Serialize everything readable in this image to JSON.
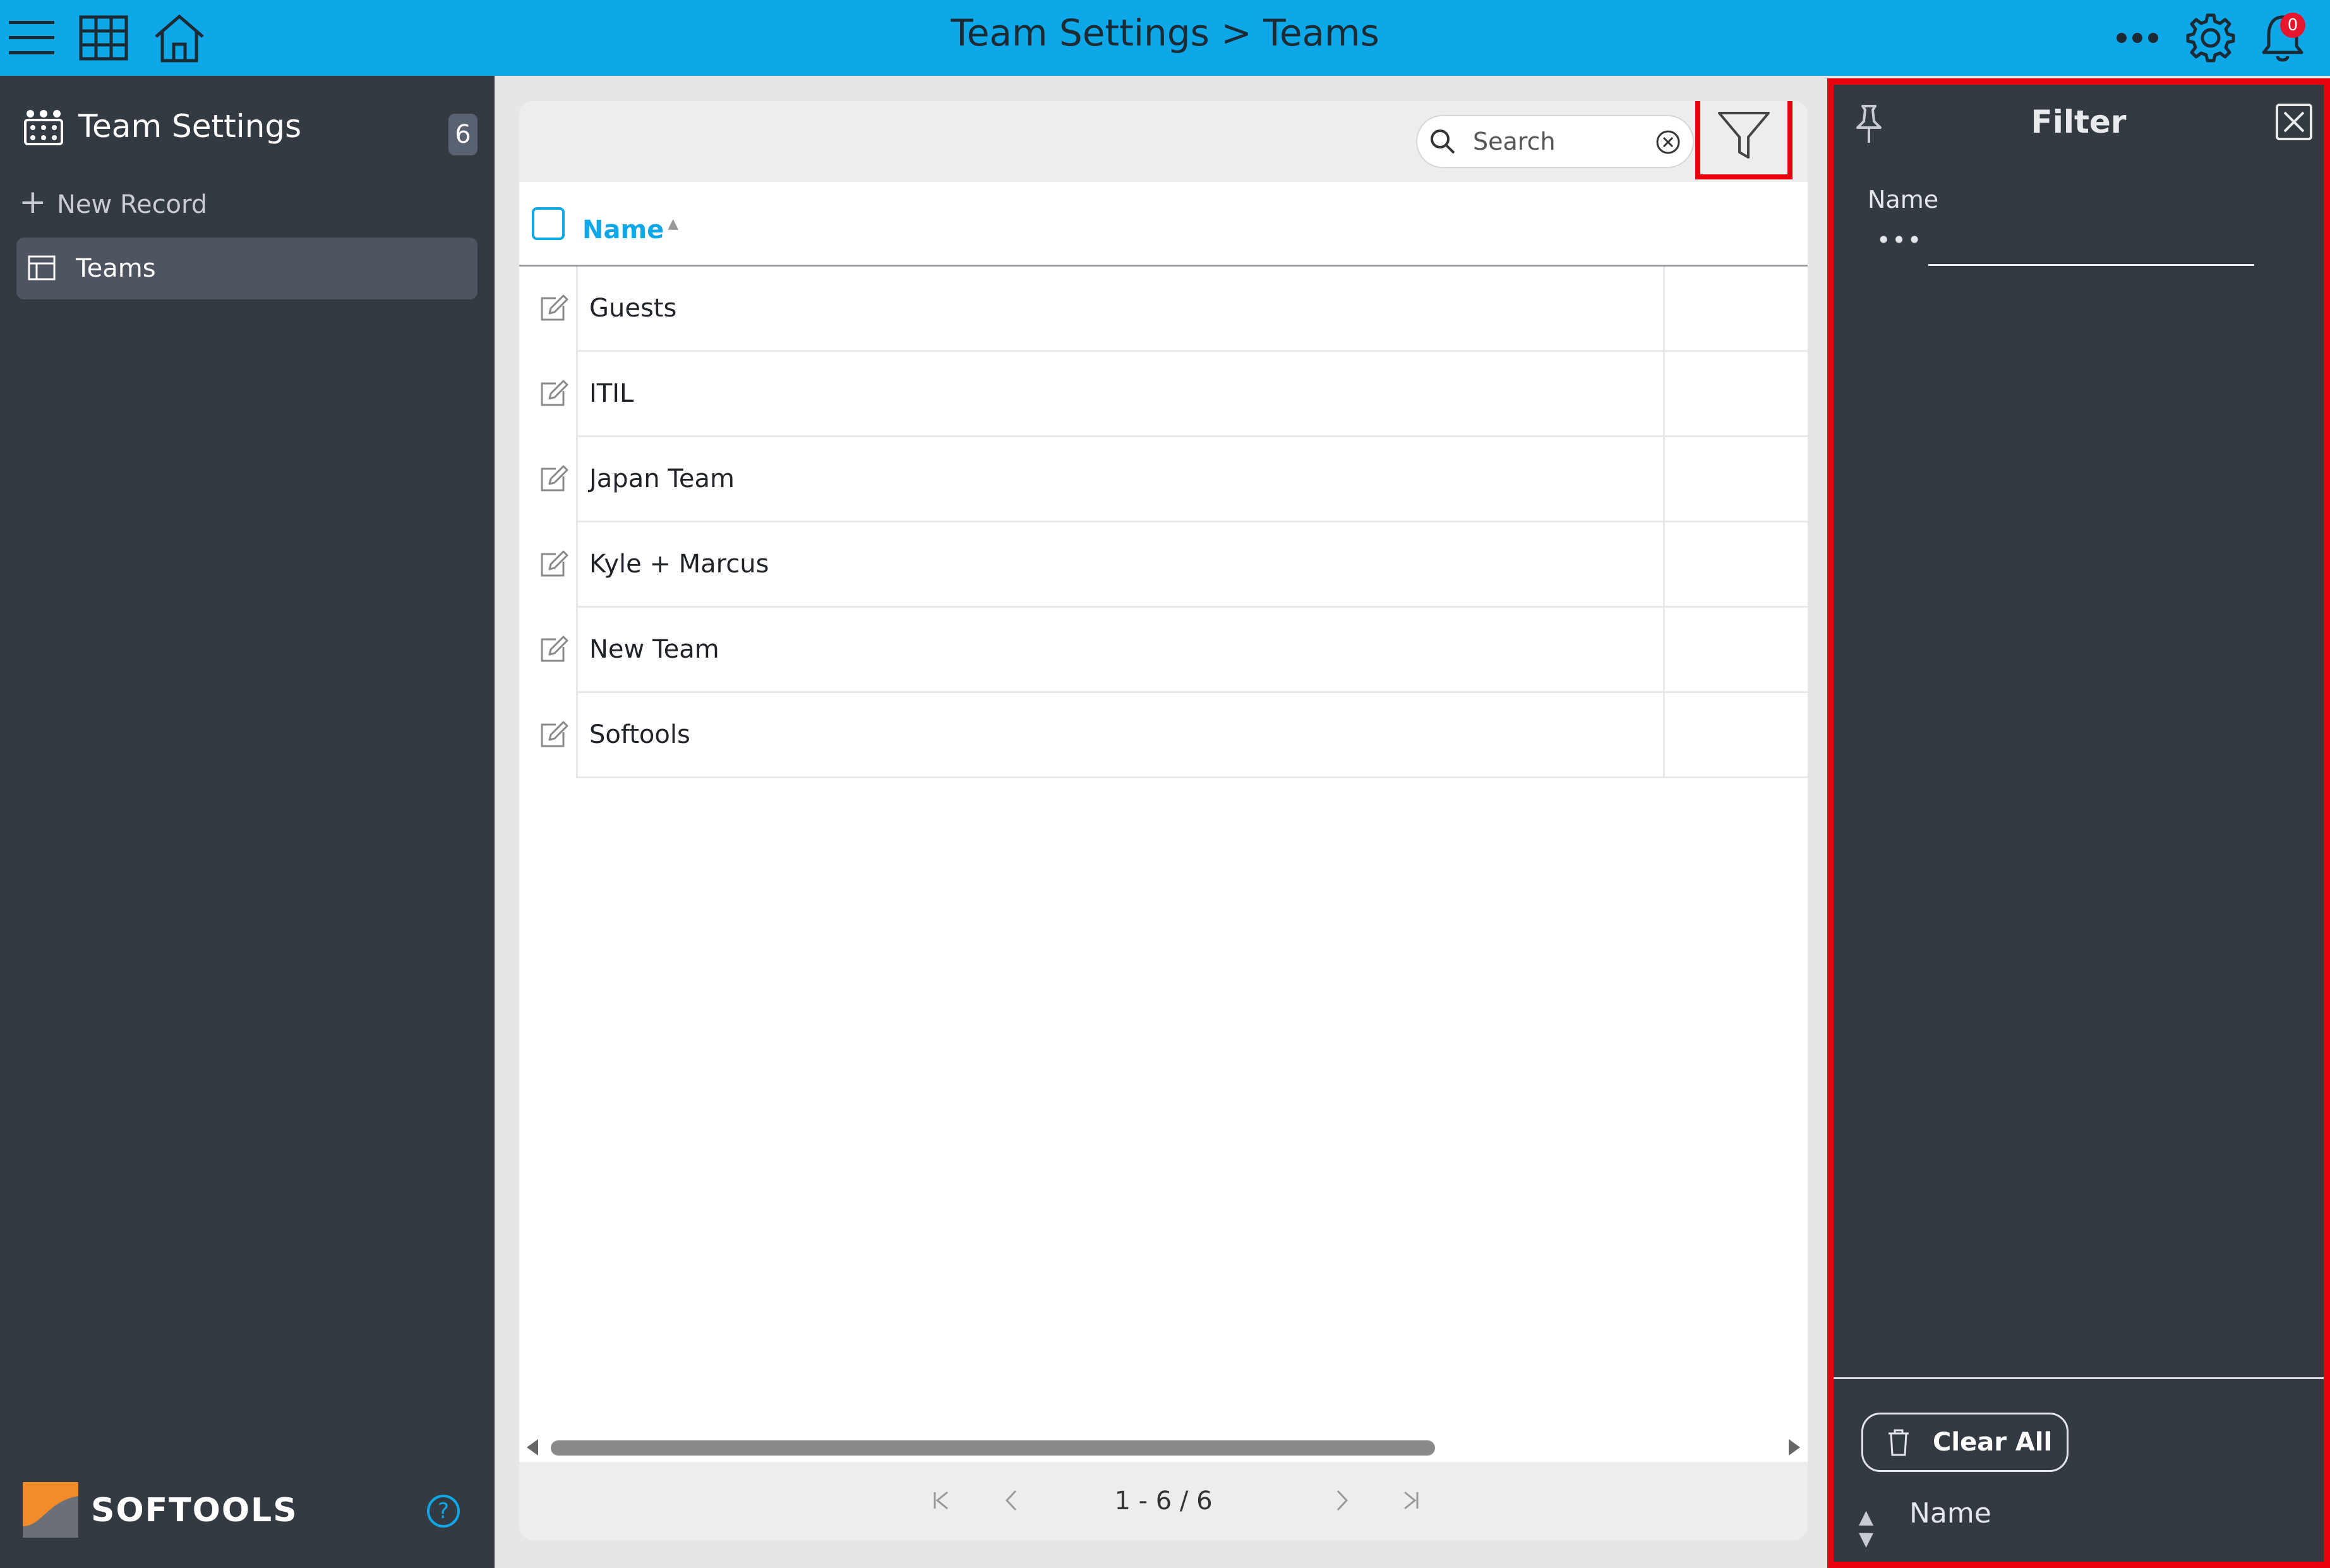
{
  "topbar": {
    "title": "Team Settings > Teams",
    "notification_count": "0",
    "icons": [
      "hamburger-menu-icon",
      "grid-icon",
      "home-icon",
      "more-dots-icon",
      "gear-icon",
      "bell-icon"
    ],
    "background": "#0ea8e8"
  },
  "sidebar": {
    "title": "Team Settings",
    "count": "6",
    "new_record_label": "New Record",
    "items": [
      {
        "label": "Teams",
        "icon": "table-icon",
        "active": true
      }
    ],
    "brand": "SOFTOOLS",
    "help_label": "?"
  },
  "toolbar": {
    "search_placeholder": "Search"
  },
  "table": {
    "columns": [
      {
        "label": "Name",
        "sort": "asc"
      }
    ],
    "rows": [
      {
        "name": "Guests"
      },
      {
        "name": "ITIL"
      },
      {
        "name": "Japan Team"
      },
      {
        "name": "Kyle + Marcus"
      },
      {
        "name": "New Team"
      },
      {
        "name": "Softools"
      }
    ]
  },
  "pager": {
    "range_text": "1 - 6 / 6"
  },
  "filter_panel": {
    "title": "Filter",
    "field_label": "Name",
    "operator_label": "•••",
    "clear_all_label": "Clear All",
    "sort_field_label": "Name"
  },
  "colors": {
    "accent": "#0ea8e8",
    "sidebar_bg": "#343a42",
    "highlight": "#e8000e",
    "badge": "#e8162c"
  }
}
